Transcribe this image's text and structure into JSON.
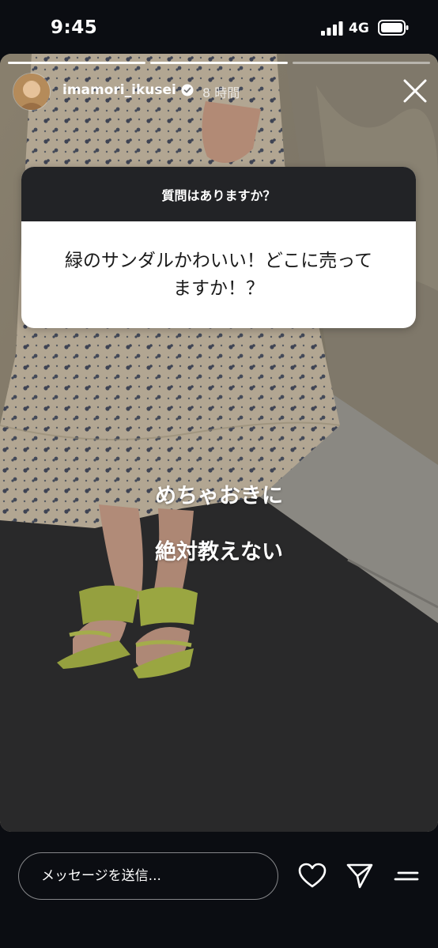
{
  "status_bar": {
    "time": "9:45",
    "network": "4G"
  },
  "story": {
    "progress": {
      "segments": 3,
      "completed": 2
    },
    "header": {
      "username": "imamori_ikusei",
      "time_ago": "8 時間"
    },
    "question_sticker": {
      "title": "質問はありますか？",
      "answer_line1": "緑のサンダルかわいい！どこに売って",
      "answer_line2": "ますか！？"
    },
    "overlay_texts": [
      "めちゃおきに",
      "絶対教えない"
    ]
  },
  "reply_bar": {
    "placeholder": "メッセージを送信..."
  },
  "icons": {
    "close": "close-icon",
    "like": "heart-icon",
    "share": "send-icon",
    "more": "more-icon"
  }
}
